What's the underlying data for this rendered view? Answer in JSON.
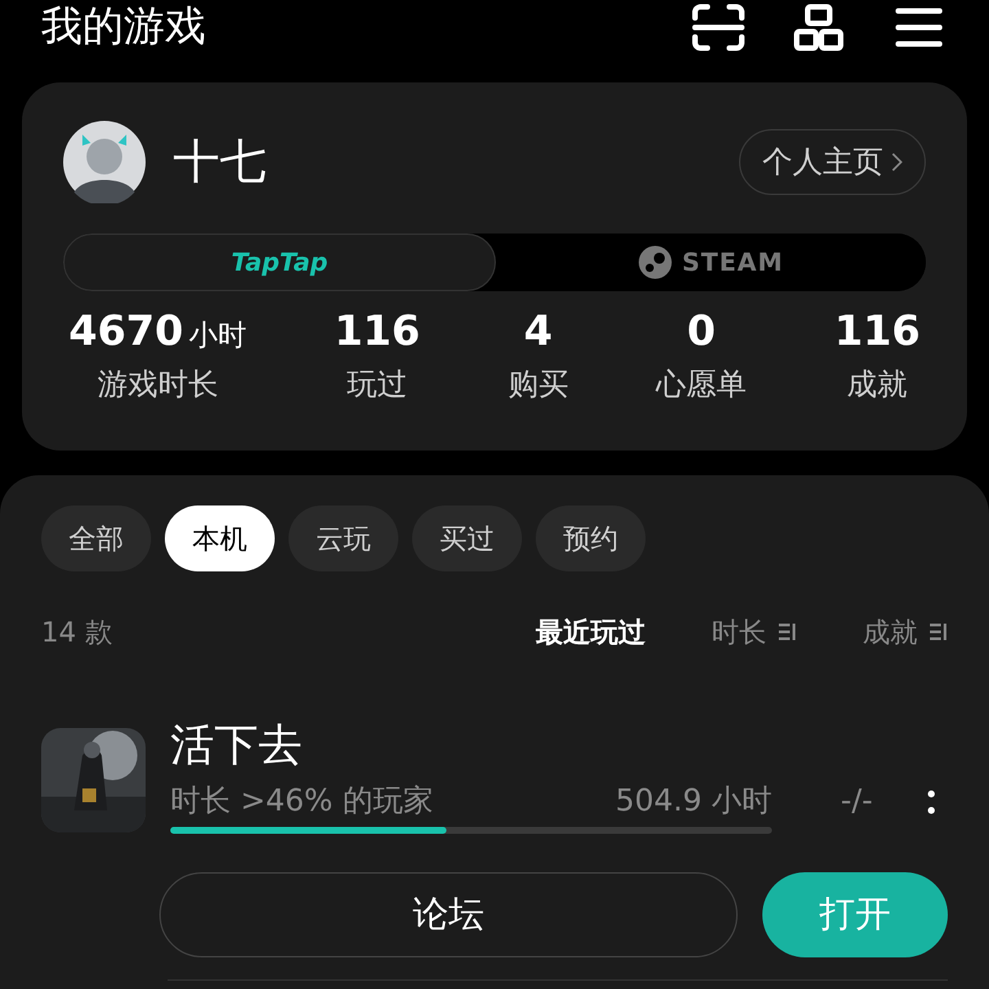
{
  "header": {
    "title": "我的游戏"
  },
  "profile": {
    "name": "十七",
    "home_button": "个人主页"
  },
  "platforms": [
    {
      "label": "TapTap",
      "selected": true
    },
    {
      "label": "STEAM",
      "selected": false
    }
  ],
  "stats": [
    {
      "value": "4670",
      "unit": "小时",
      "label": "游戏时长"
    },
    {
      "value": "116",
      "label": "玩过"
    },
    {
      "value": "4",
      "label": "购买"
    },
    {
      "value": "0",
      "label": "心愿单"
    },
    {
      "value": "116",
      "label": "成就"
    }
  ],
  "filters": [
    {
      "label": "全部",
      "selected": false
    },
    {
      "label": "本机",
      "selected": true
    },
    {
      "label": "云玩",
      "selected": false
    },
    {
      "label": "买过",
      "selected": false
    },
    {
      "label": "预约",
      "selected": false
    }
  ],
  "count": "14 款",
  "sorts": [
    {
      "label": "最近玩过",
      "selected": true,
      "sort_icon": false
    },
    {
      "label": "时长",
      "selected": false,
      "sort_icon": true
    },
    {
      "label": "成就",
      "selected": false,
      "sort_icon": true
    }
  ],
  "games": [
    {
      "title": "活下去",
      "rank": "时长 >46% 的玩家",
      "hours": "504.9 小时",
      "level": 0.46,
      "achievements": "-/-",
      "buttons": [
        "论坛",
        "打开"
      ]
    }
  ]
}
